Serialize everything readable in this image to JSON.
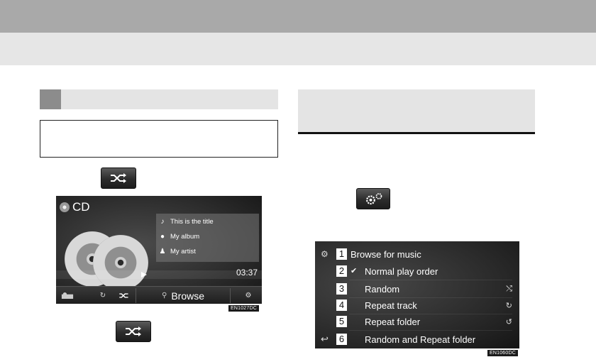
{
  "cd_screen": {
    "source_title": "CD",
    "track": {
      "title": "This is the title",
      "album": "My album",
      "artist": "My artist"
    },
    "time": "03:37",
    "browse_label": "Browse"
  },
  "figure_codes": {
    "left": "EN1027DC",
    "right": "EN1060DC"
  },
  "menu_screen": {
    "rows": [
      {
        "num": "1",
        "label": "Browse for music"
      },
      {
        "num": "2",
        "label": "Normal play order"
      },
      {
        "num": "3",
        "label": "Random"
      },
      {
        "num": "4",
        "label": "Repeat track"
      },
      {
        "num": "5",
        "label": "Repeat folder"
      },
      {
        "num": "6",
        "label": "Random and Repeat folder"
      }
    ]
  }
}
